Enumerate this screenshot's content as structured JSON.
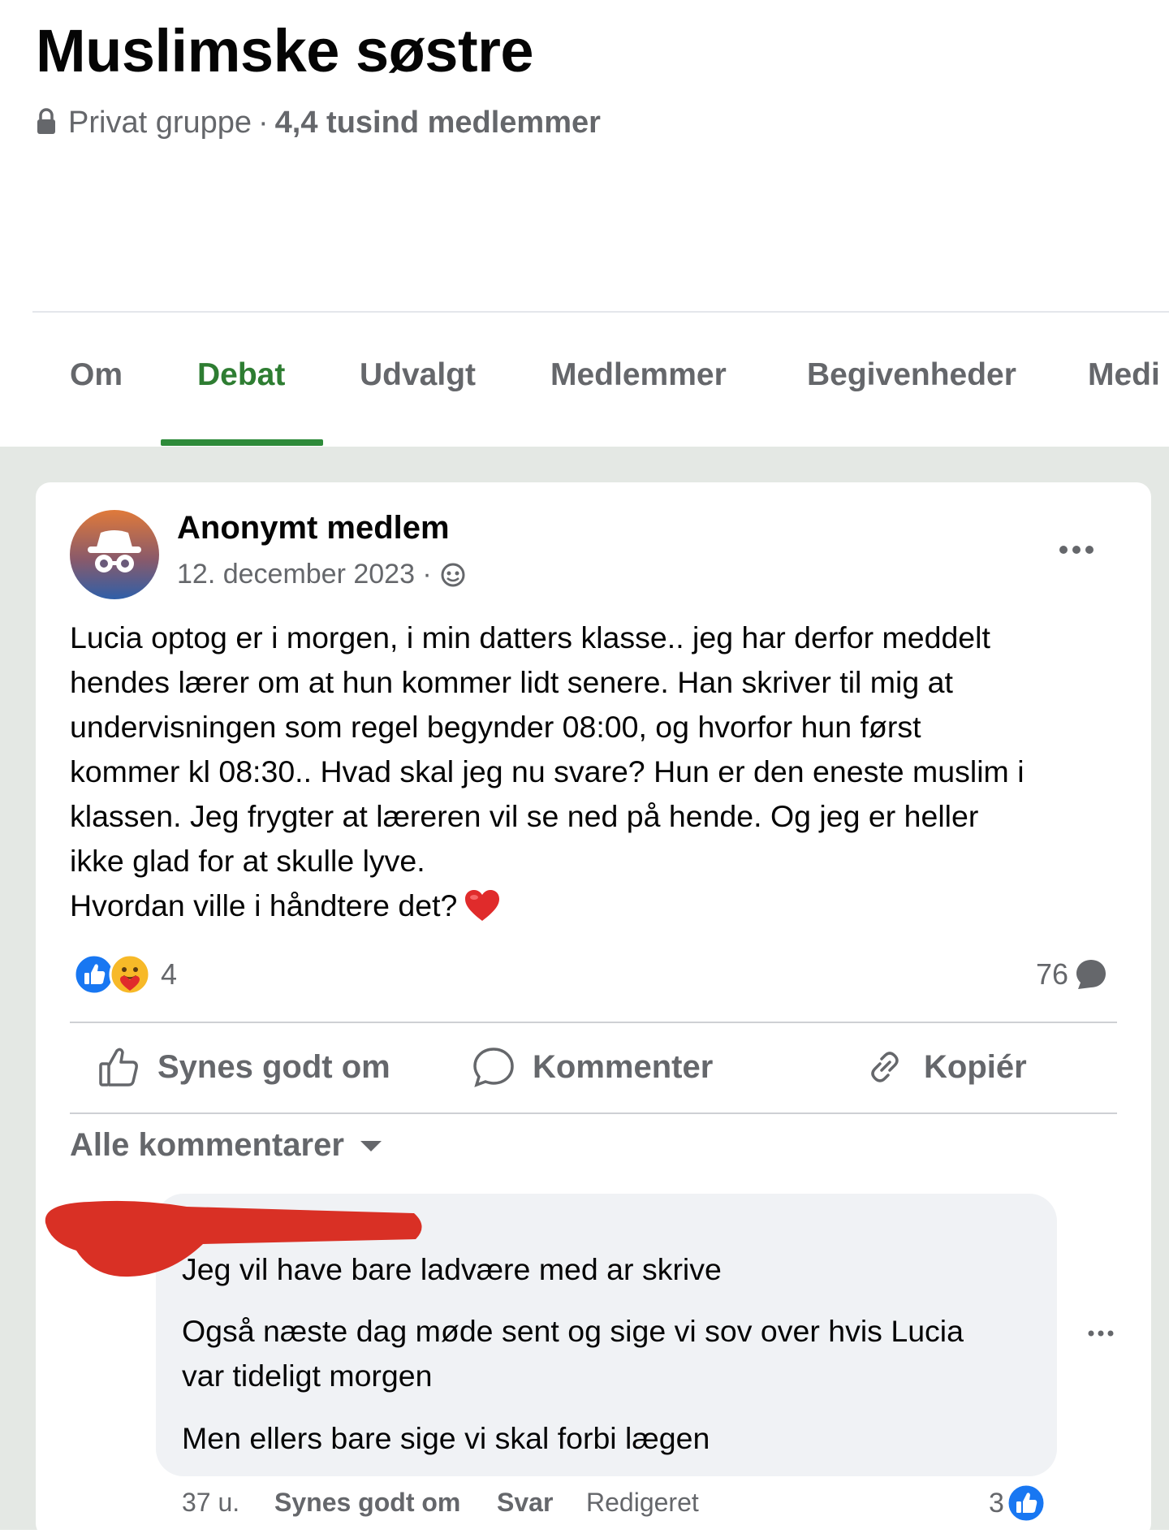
{
  "group": {
    "title": "Muslimske søstre",
    "privacy": "Privat gruppe",
    "separator": "·",
    "members": "4,4 tusind medlemmer"
  },
  "tabs": [
    {
      "label": "Om",
      "active": false
    },
    {
      "label": "Debat",
      "active": true
    },
    {
      "label": "Udvalgt",
      "active": false
    },
    {
      "label": "Medlemmer",
      "active": false
    },
    {
      "label": "Begivenheder",
      "active": false
    },
    {
      "label": "Medi",
      "active": false
    }
  ],
  "post": {
    "author": "Anonymt medlem",
    "date": "12. december 2023 ·",
    "body_lines": [
      "Lucia optog er i morgen, i min datters klasse.. jeg har derfor meddelt",
      "hendes lærer om at hun kommer lidt senere. Han skriver til mig at",
      "undervisningen som regel begynder 08:00, og hvorfor hun først",
      "kommer kl 08:30.. Hvad skal jeg nu svare? Hun er den eneste muslim i",
      "klassen. Jeg frygter at læreren vil se ned på hende. Og jeg er heller",
      "ikke glad for at skulle lyve.",
      "Hvordan ville i håndtere det?"
    ],
    "reaction_count": "4",
    "comment_count": "76"
  },
  "actions": {
    "like": "Synes godt om",
    "comment": "Kommenter",
    "copy": "Kopiér"
  },
  "comments_filter": "Alle kommentarer",
  "comment": {
    "lines": [
      "Jeg vil have bare ladvære med ar skrive",
      "Også næste dag møde sent og sige vi sov over hvis Lucia",
      "var tideligt morgen",
      "Men ellers bare sige vi skal forbi lægen"
    ],
    "time": "37 u.",
    "like_label": "Synes godt om",
    "reply_label": "Svar",
    "edited": "Redigeret",
    "like_count": "3"
  },
  "colors": {
    "accent_green": "#2e7d32",
    "fb_blue": "#1877f2",
    "redaction": "#d93025"
  },
  "icons": [
    "lock-icon",
    "globe-icon",
    "more-icon",
    "heart-icon",
    "like-reaction-icon",
    "care-reaction-icon",
    "comment-bubble-icon",
    "thumbs-up-icon",
    "comment-icon",
    "link-icon",
    "caret-down-icon"
  ]
}
